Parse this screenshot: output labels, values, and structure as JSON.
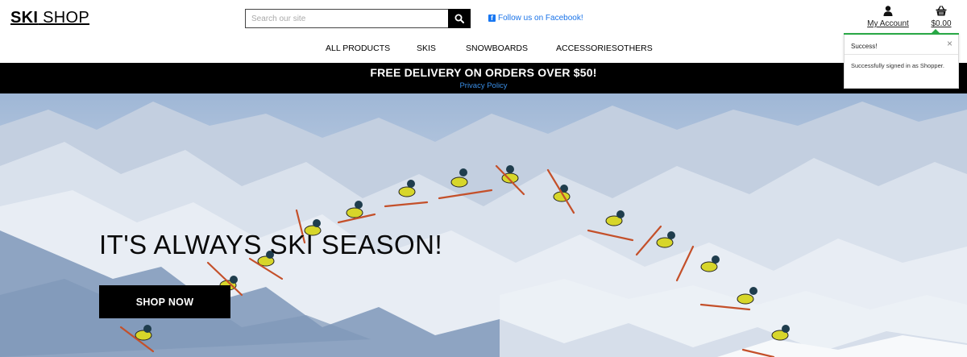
{
  "logo": {
    "bold": "SKI",
    "rest": " SHOP"
  },
  "search": {
    "placeholder": "Search our site",
    "value": ""
  },
  "social": {
    "label": "Follow us on Facebook!"
  },
  "account": {
    "label": "My Account"
  },
  "bag": {
    "total": "$0.00"
  },
  "nav": {
    "items": [
      {
        "label": "ALL PRODUCTS"
      },
      {
        "label": "SKIS"
      },
      {
        "label": "SNOWBOARDS"
      },
      {
        "label": "ACCESSORIES"
      },
      {
        "label": "OTHERS"
      }
    ]
  },
  "banner": {
    "headline": "FREE DELIVERY ON ORDERS OVER $50!",
    "link": "Privacy Policy"
  },
  "hero": {
    "title": "IT'S ALWAYS SKI SEASON!",
    "cta": "SHOP NOW"
  },
  "toast": {
    "title": "Success!",
    "message": "Successfully signed in as Shopper.",
    "close": "×",
    "status_color": "#28a745"
  },
  "colors": {
    "accent": "#000000",
    "link": "#1a73e8",
    "success": "#28a745"
  },
  "icons": [
    "search-icon",
    "facebook-icon",
    "user-icon",
    "shopping-basket-icon",
    "close-icon"
  ]
}
